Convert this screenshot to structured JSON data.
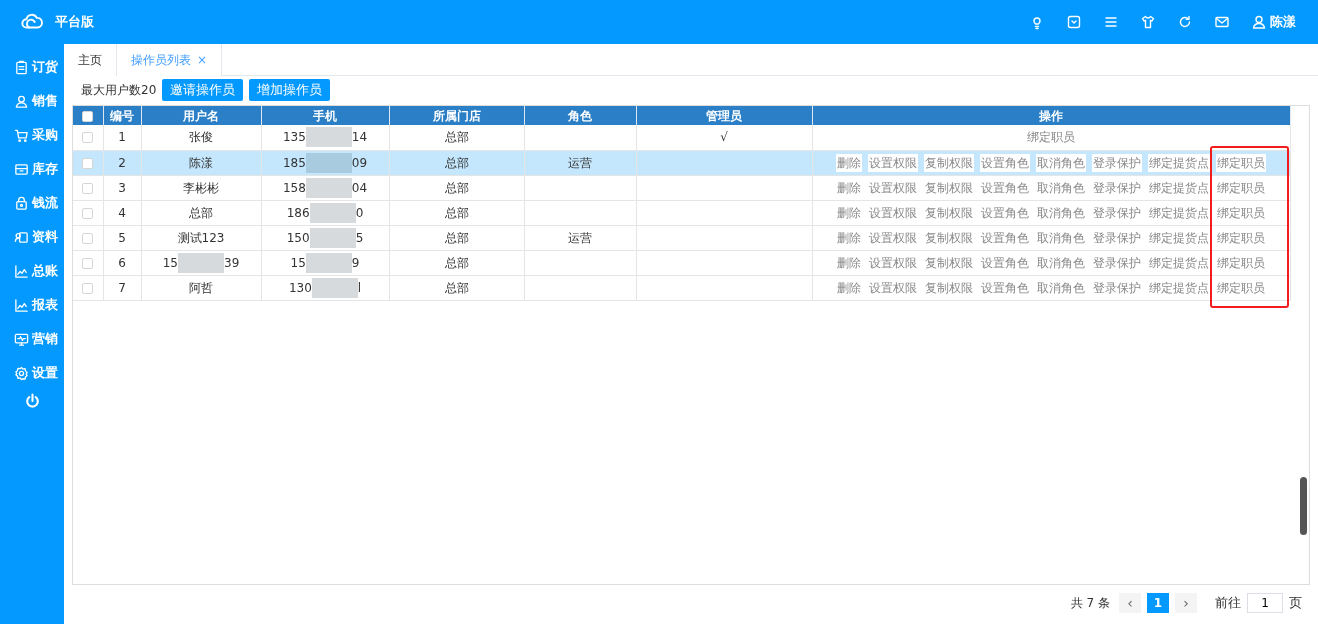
{
  "header": {
    "title": "平台版",
    "user": "陈漾"
  },
  "sidebar": {
    "items": [
      {
        "label": "订货"
      },
      {
        "label": "销售"
      },
      {
        "label": "采购"
      },
      {
        "label": "库存"
      },
      {
        "label": "钱流"
      },
      {
        "label": "资料"
      },
      {
        "label": "总账"
      },
      {
        "label": "报表"
      },
      {
        "label": "营销"
      },
      {
        "label": "设置"
      }
    ]
  },
  "tabs": [
    {
      "label": "主页",
      "selected": false
    },
    {
      "label": "操作员列表",
      "selected": true,
      "close": "×"
    }
  ],
  "toolbar": {
    "max_users": "最大用户数20",
    "buttons": [
      "邀请操作员",
      "增加操作员"
    ]
  },
  "table": {
    "select_all_checked": false,
    "columns": [
      "编号",
      "用户名",
      "手机",
      "所属门店",
      "角色",
      "管理员",
      "操作"
    ],
    "rows": [
      {
        "selected": false,
        "no": "1",
        "username": [
          "张俊"
        ],
        "phone": [
          "135",
          "14"
        ],
        "store": "总部",
        "role": "",
        "admin": "√",
        "actions": [
          "绑定职员"
        ]
      },
      {
        "selected": true,
        "no": "2",
        "username": [
          "陈漾"
        ],
        "phone": [
          "185",
          "09"
        ],
        "store": "总部",
        "role": "运营",
        "admin": "",
        "actions": [
          "删除",
          "设置权限",
          "复制权限",
          "设置角色",
          "取消角色",
          "登录保护",
          "绑定提货点",
          "绑定职员"
        ]
      },
      {
        "selected": false,
        "no": "3",
        "username": [
          "李彬彬"
        ],
        "phone": [
          "158",
          "04"
        ],
        "store": "总部",
        "role": "",
        "admin": "",
        "actions": [
          "删除",
          "设置权限",
          "复制权限",
          "设置角色",
          "取消角色",
          "登录保护",
          "绑定提货点",
          "绑定职员"
        ]
      },
      {
        "selected": false,
        "no": "4",
        "username": [
          "总部"
        ],
        "phone": [
          "186",
          "0"
        ],
        "store": "总部",
        "role": "",
        "admin": "",
        "actions": [
          "删除",
          "设置权限",
          "复制权限",
          "设置角色",
          "取消角色",
          "登录保护",
          "绑定提货点",
          "绑定职员"
        ]
      },
      {
        "selected": false,
        "no": "5",
        "username": [
          "测试123"
        ],
        "phone": [
          "150",
          "5"
        ],
        "store": "总部",
        "role": "运营",
        "admin": "",
        "actions": [
          "删除",
          "设置权限",
          "复制权限",
          "设置角色",
          "取消角色",
          "登录保护",
          "绑定提货点",
          "绑定职员"
        ]
      },
      {
        "selected": false,
        "no": "6",
        "username": [
          "15",
          "39"
        ],
        "phone": [
          "15",
          "9"
        ],
        "store": "总部",
        "role": "",
        "admin": "",
        "actions": [
          "删除",
          "设置权限",
          "复制权限",
          "设置角色",
          "取消角色",
          "登录保护",
          "绑定提货点",
          "绑定职员"
        ]
      },
      {
        "selected": false,
        "no": "7",
        "username": [
          "阿哲"
        ],
        "phone": [
          "130",
          "l"
        ],
        "store": "总部",
        "role": "",
        "admin": "",
        "actions": [
          "删除",
          "设置权限",
          "复制权限",
          "设置角色",
          "取消角色",
          "登录保护",
          "绑定提货点",
          "绑定职员"
        ]
      }
    ]
  },
  "annotation": {
    "kind": "box"
  },
  "pagination": {
    "total": "共 7 条",
    "prev": "‹",
    "pages": [
      {
        "label": "1",
        "selected": true
      }
    ],
    "next": "›",
    "goto": "前往",
    "goto_value": "1",
    "page_unit": "页"
  }
}
